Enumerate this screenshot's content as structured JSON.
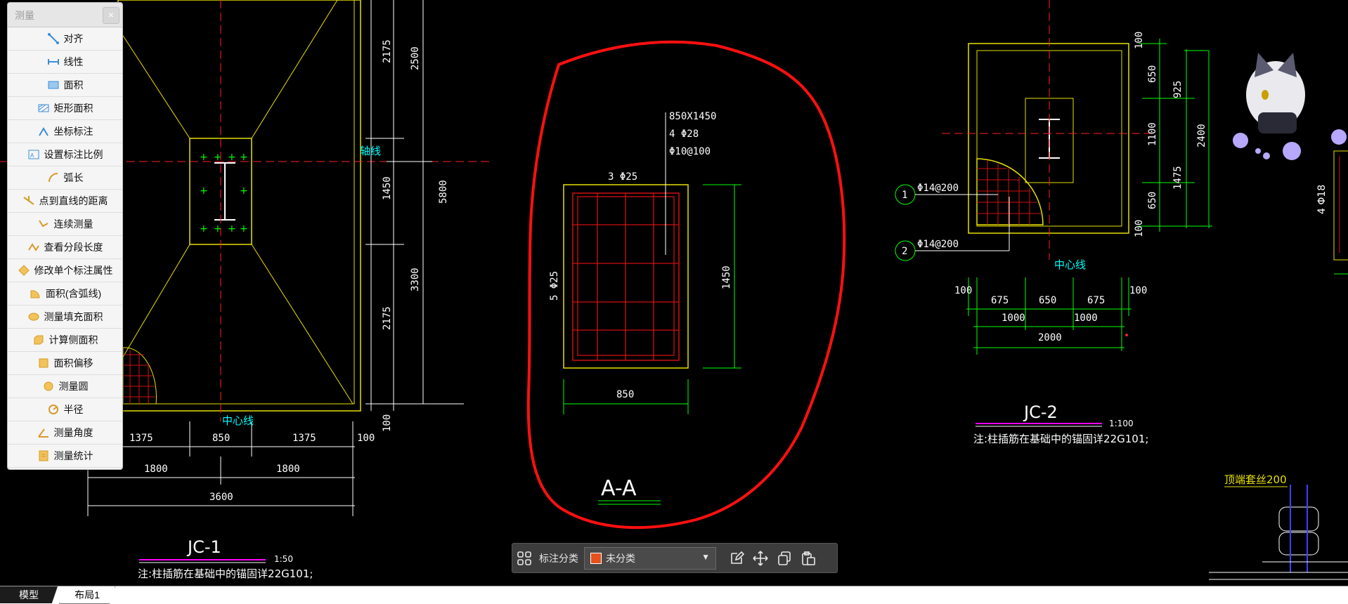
{
  "measure_panel": {
    "title": "测量",
    "close": "×",
    "items": [
      {
        "label": "对齐",
        "icon": "align-measure-icon"
      },
      {
        "label": "线性",
        "icon": "linear-measure-icon"
      },
      {
        "label": "面积",
        "icon": "area-icon"
      },
      {
        "label": "矩形面积",
        "icon": "rect-area-icon"
      },
      {
        "label": "坐标标注",
        "icon": "coordinate-icon"
      },
      {
        "label": "设置标注比例",
        "icon": "scale-icon"
      },
      {
        "label": "弧长",
        "icon": "arc-length-icon"
      },
      {
        "label": "点到直线的距离",
        "icon": "point-line-distance-icon"
      },
      {
        "label": "连续测量",
        "icon": "continuous-measure-icon"
      },
      {
        "label": "查看分段长度",
        "icon": "segment-length-icon"
      },
      {
        "label": "修改单个标注属性",
        "icon": "edit-annotation-icon"
      },
      {
        "label": "面积(含弧线)",
        "icon": "arc-area-icon"
      },
      {
        "label": "测量填充面积",
        "icon": "hatch-area-icon"
      },
      {
        "label": "计算侧面积",
        "icon": "side-area-icon"
      },
      {
        "label": "面积偏移",
        "icon": "area-offset-icon"
      },
      {
        "label": "测量圆",
        "icon": "circle-measure-icon"
      },
      {
        "label": "半径",
        "icon": "radius-icon"
      },
      {
        "label": "测量角度",
        "icon": "angle-icon"
      },
      {
        "label": "测量统计",
        "icon": "statistics-icon"
      }
    ]
  },
  "toolbar": {
    "category_label": "标注分类",
    "selected_category": "未分类",
    "swatch_color": "#e8501c"
  },
  "tabs": {
    "model": "模型",
    "layout1": "布局1"
  },
  "drawing": {
    "left": {
      "axis": "轴线",
      "center": "中心线",
      "dims_v": [
        "2175",
        "2500",
        "1450",
        "5800",
        "3300",
        "2175",
        "100"
      ],
      "dims_h": [
        "1375",
        "850",
        "1375",
        "100",
        "1800",
        "1800",
        "3600"
      ],
      "title": "JC-1",
      "scale": "1:50",
      "note": "注:柱插筋在基础中的锚固详22G101;"
    },
    "section": {
      "spec1": "850X1450",
      "spec2": "4 Φ28",
      "spec3": "Φ10@100",
      "top_bar": "3 Φ25",
      "side_bar": "5 Φ25",
      "height": "1450",
      "width": "850",
      "title": "A-A"
    },
    "right": {
      "dims_v": [
        "100",
        "650",
        "925",
        "1100",
        "2400",
        "1475",
        "650",
        "100"
      ],
      "dims_h": [
        "100",
        "675",
        "650",
        "675",
        "100",
        "1000",
        "1000",
        "2000"
      ],
      "rebar1": "Φ14@200",
      "rebar2": "Φ14@200",
      "marker1": "1",
      "marker2": "2",
      "center": "中心线",
      "title": "JC-2",
      "scale": "1:100",
      "note": "注:柱插筋在基础中的锚固详22G101;",
      "bolt_label": "顶端套丝200",
      "far_label": "4 Φ18"
    }
  }
}
